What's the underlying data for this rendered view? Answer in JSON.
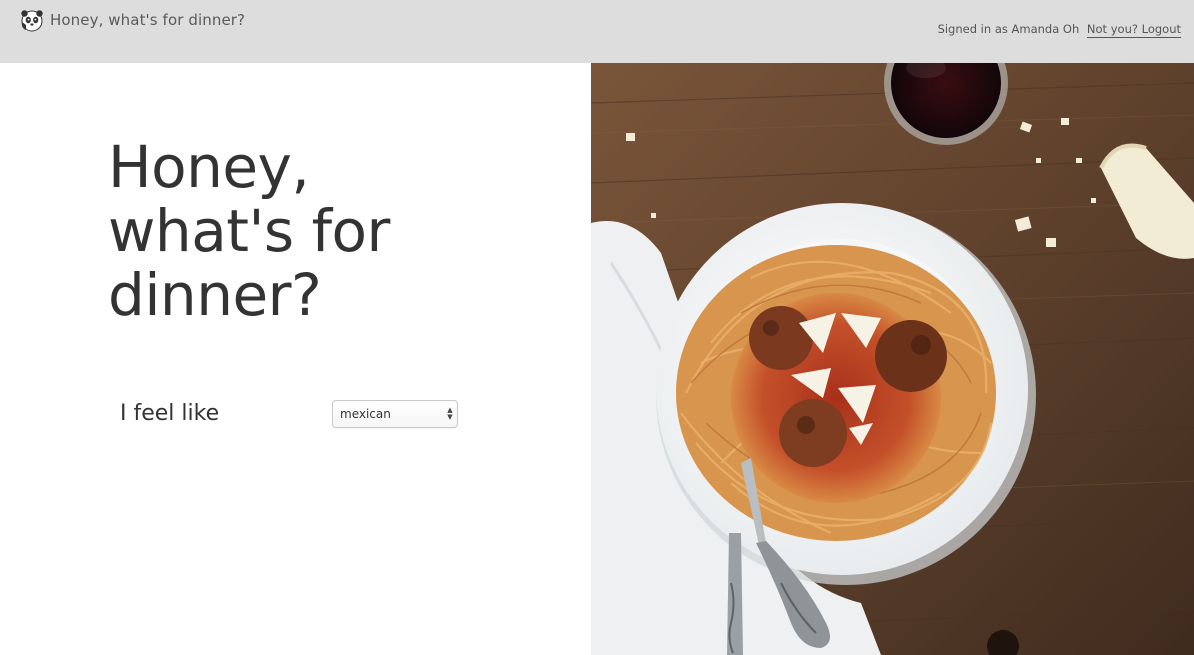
{
  "header": {
    "brand_title": "Honey, what's for dinner?",
    "logo_icon": "panda-icon",
    "session_text": "Signed in as Amanda Oh",
    "logout_label": "Not you? Logout"
  },
  "main": {
    "hero_title": "Honey, what's for dinner?",
    "feel_label": "I feel like",
    "cuisine_select": {
      "selected": "mexican"
    }
  },
  "photo": {
    "subject": "spaghetti-meatballs-photo"
  },
  "colors": {
    "header_bg": "#dddddd",
    "text_dark": "#333333",
    "text_muted": "#555555",
    "wood": "#6b4a33",
    "sauce": "#b8391f"
  }
}
